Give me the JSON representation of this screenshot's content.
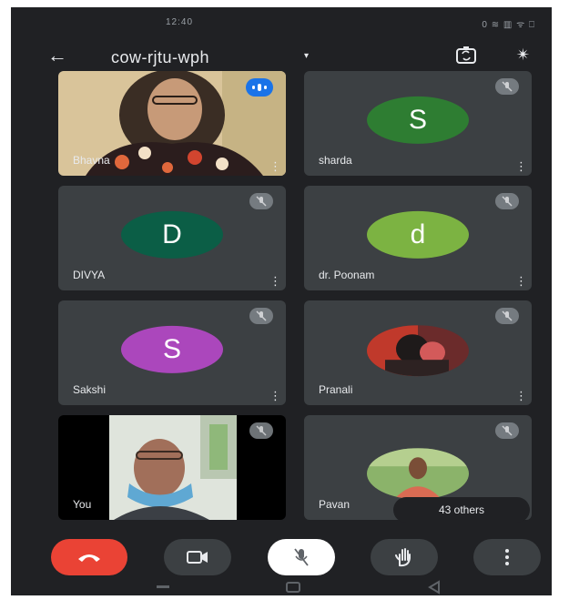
{
  "status_bar": {
    "time": "12:40",
    "right_icons": "0 ≋ ▥ ᯤ ⎕"
  },
  "header": {
    "meeting_code": "cow-rjtu-wph",
    "caret": "▾"
  },
  "participants": [
    {
      "name": "Bhavna",
      "type": "video"
    },
    {
      "name": "sharda",
      "initial": "S",
      "avatar_color": "#2e7d32"
    },
    {
      "name": "DIVYA",
      "initial": "D",
      "avatar_color": "#0b5e46"
    },
    {
      "name": "dr. Poonam",
      "initial": "d",
      "avatar_color": "#7cb342"
    },
    {
      "name": "Sakshi",
      "initial": "S",
      "avatar_color": "#ab47bc"
    },
    {
      "name": "Pranali",
      "type": "photo"
    },
    {
      "name": "You",
      "type": "self-video"
    },
    {
      "name": "Pavan",
      "type": "photo"
    }
  ],
  "others_label": "43 others",
  "colors": {
    "background": "#202124",
    "tile": "#3c4043",
    "end_call": "#ea4335",
    "mic_button": "#ffffff",
    "speaking": "#1a73e8"
  }
}
